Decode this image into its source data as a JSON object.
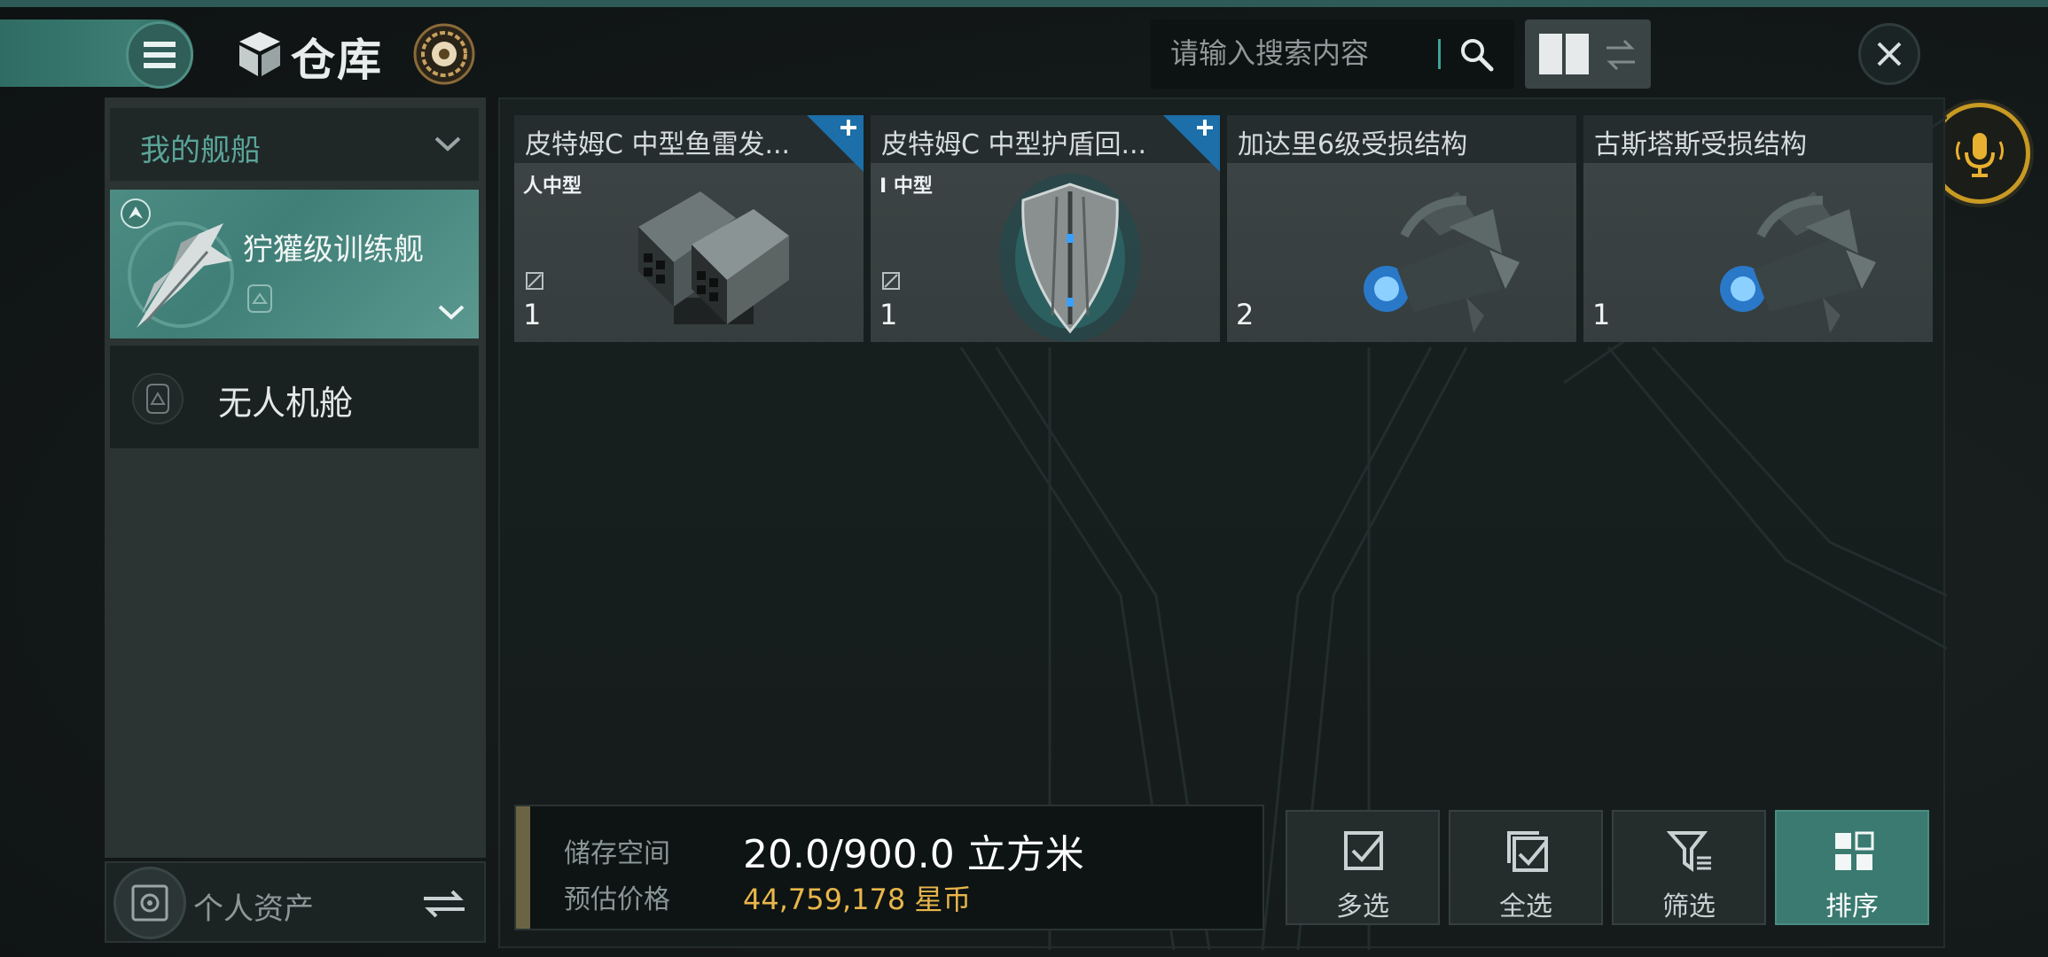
{
  "header": {
    "title": "仓库",
    "search_placeholder": "请输入搜索内容"
  },
  "sidebar": {
    "ship_dropdown_label": "我的舰船",
    "ship_name": "狞獾级训练舰",
    "drone_bay_label": "无人机舱",
    "personal_assets_label": "个人资产"
  },
  "items": [
    {
      "name": "皮特姆C 中型鱼雷发...",
      "size_tag": "人中型",
      "qty": "1",
      "has_plus": true,
      "art": "torpedo-launcher"
    },
    {
      "name": "皮特姆C 中型护盾回...",
      "size_tag": "I 中型",
      "qty": "1",
      "has_plus": true,
      "art": "shield-booster"
    },
    {
      "name": "加达里6级受损结构",
      "size_tag": "",
      "qty": "2",
      "has_plus": false,
      "art": "damaged-structure"
    },
    {
      "name": "古斯塔斯受损结构",
      "size_tag": "",
      "qty": "1",
      "has_plus": false,
      "art": "damaged-structure"
    }
  ],
  "storage": {
    "space_label": "储存空间",
    "space_value": "20.0/900.0 立方米",
    "price_label": "预估价格",
    "price_value": "44,759,178 星币"
  },
  "actions": [
    {
      "label": "多选",
      "icon": "checkbox-icon"
    },
    {
      "label": "全选",
      "icon": "select-all-icon"
    },
    {
      "label": "筛选",
      "icon": "filter-icon"
    },
    {
      "label": "排序",
      "icon": "sort-icon",
      "active": true
    }
  ],
  "colors": {
    "accent_teal": "#3a7a70",
    "price_gold": "#e8b64a",
    "plus_blue": "#1c6fa8",
    "voice_gold": "#c89a22"
  }
}
